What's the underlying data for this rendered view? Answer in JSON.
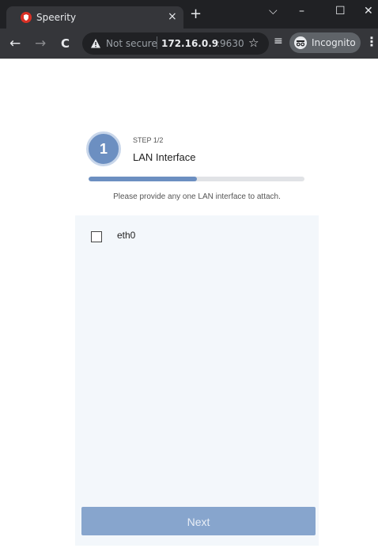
{
  "browser": {
    "tab_title": "Speerity",
    "tab_close": "×",
    "new_tab": "+",
    "window_controls": [
      "⌵",
      "–",
      "☐",
      "✕"
    ],
    "nav": {
      "back": "←",
      "forward": "→",
      "reload": "C"
    },
    "omnibox": {
      "security_text": "Not secure",
      "host": "172.16.0.9",
      "port": ":9630"
    },
    "star": "☆",
    "media": "≡",
    "incognito_label": "Incognito",
    "menu": "⋮"
  },
  "wizard": {
    "step_number": "1",
    "step_count": "STEP 1/2",
    "step_title": "LAN Interface",
    "progress_fraction": 0.5,
    "description": "Please provide any one LAN interface to attach.",
    "interfaces": [
      {
        "label": "eth0",
        "checked": false
      }
    ],
    "next_label": "Next"
  },
  "colors": {
    "accent": "#6c8fc1",
    "button_disabled": "#87a5cd",
    "panel_bg": "#f3f7fb"
  }
}
